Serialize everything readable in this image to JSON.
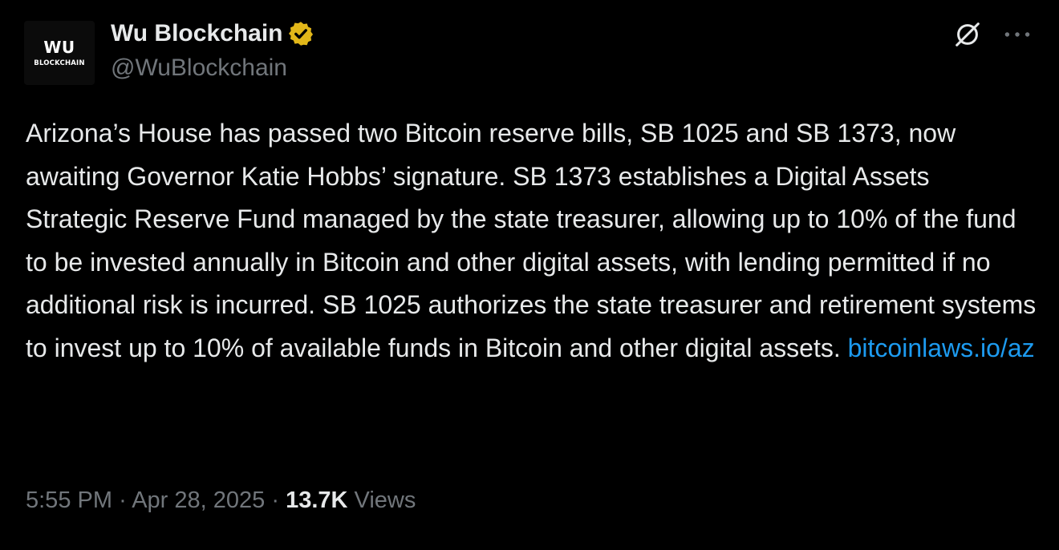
{
  "author": {
    "avatar_line1": "WU",
    "avatar_line2": "BLOCKCHAIN",
    "display_name": "Wu Blockchain",
    "handle": "@WuBlockchain",
    "verified_color": "#e2b719"
  },
  "post": {
    "text": "Arizona’s House has passed two Bitcoin reserve bills, SB 1025 and SB 1373, now awaiting Governor Katie Hobbs’ signature. SB 1373 establishes a Digital Assets Strategic Reserve Fund managed by the state treasurer, allowing up to 10% of the fund to be invested annually in Bitcoin and other digital assets, with lending permitted if no additional risk is incurred. SB 1025 authorizes the state treasurer and retirement systems to invest up to 10% of available funds in Bitcoin and other digital assets.",
    "link_text": "bitcoinlaws.io/az",
    "link_color": "#1d9bf0"
  },
  "meta": {
    "time": "5:55 PM",
    "separator": "·",
    "date": "Apr 28, 2025",
    "views_count": "13.7K",
    "views_label": "Views"
  },
  "icons": {
    "grok": "grok-icon",
    "more": "more-icon",
    "verified": "verified-badge-icon"
  },
  "colors": {
    "background": "#000000",
    "text_primary": "#e7e9ea",
    "text_secondary": "#71767b"
  }
}
